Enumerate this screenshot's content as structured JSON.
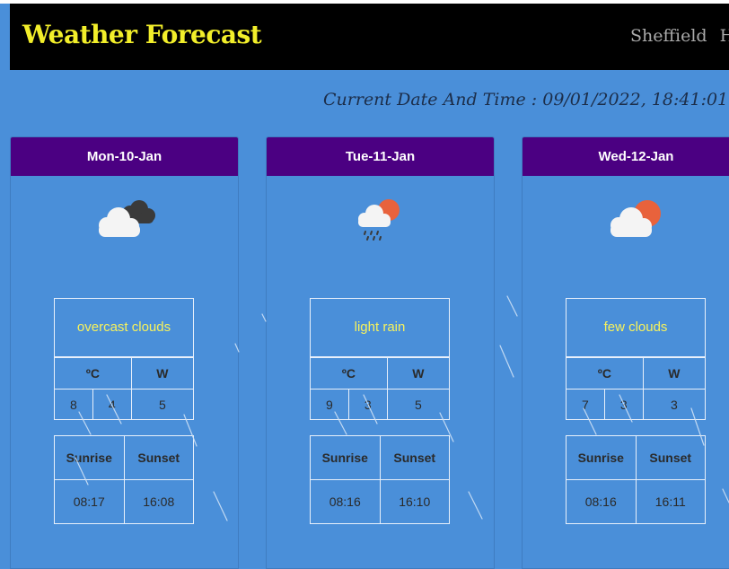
{
  "header": {
    "brand": "Weather Forecast",
    "nav": [
      "Sheffield",
      "Hy"
    ]
  },
  "datetime": "Current Date And Time : 09/01/2022, 18:41:01",
  "table_labels": {
    "celsius": "ºC",
    "wind": "W",
    "sunrise": "Sunrise",
    "sunset": "Sunset"
  },
  "days": [
    {
      "date": "Mon-10-Jan",
      "icon": "overcast-clouds-icon",
      "description": "overcast clouds",
      "temp_high": "8",
      "temp_low": "4",
      "wind": "5",
      "sunrise": "08:17",
      "sunset": "16:08"
    },
    {
      "date": "Tue-11-Jan",
      "icon": "light-rain-icon",
      "description": "light rain",
      "temp_high": "9",
      "temp_low": "3",
      "wind": "5",
      "sunrise": "08:16",
      "sunset": "16:10"
    },
    {
      "date": "Wed-12-Jan",
      "icon": "few-clouds-icon",
      "description": "few clouds",
      "temp_high": "7",
      "temp_low": "3",
      "wind": "3",
      "sunrise": "08:16",
      "sunset": "16:11"
    }
  ],
  "colors": {
    "background": "#4a8fd9",
    "header": "#000000",
    "brand": "#f2ee2a",
    "card_header": "#4b0082",
    "description_text": "#f7f25c",
    "sun": "#e8623c"
  }
}
